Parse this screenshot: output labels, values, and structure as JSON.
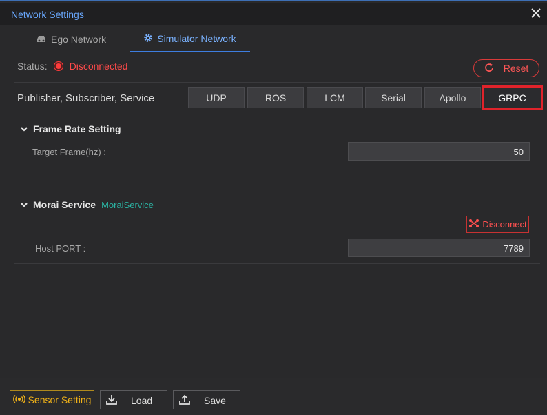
{
  "window": {
    "title": "Network Settings"
  },
  "tabs": [
    {
      "label": "Ego Network",
      "icon": "car-icon",
      "active": false
    },
    {
      "label": "Simulator Network",
      "icon": "gear-icon",
      "active": true
    }
  ],
  "status": {
    "label": "Status:",
    "value": "Disconnected",
    "color": "#ff4a4a"
  },
  "reset_label": "Reset",
  "protocols": {
    "label": "Publisher, Subscriber, Service",
    "items": [
      "UDP",
      "ROS",
      "LCM",
      "Serial",
      "Apollo",
      "GRPC"
    ],
    "selected": "GRPC"
  },
  "frame_rate": {
    "heading": "Frame Rate Setting",
    "target_label": "Target Frame(hz) :",
    "target_value": "50"
  },
  "morai_service": {
    "heading": "Morai Service",
    "service_name": "MoraiService",
    "disconnect_label": "Disconnect",
    "host_port_label": "Host PORT :",
    "host_port_value": "7789"
  },
  "footer": {
    "sensor_label": "Sensor Setting",
    "load_label": "Load",
    "save_label": "Save"
  }
}
